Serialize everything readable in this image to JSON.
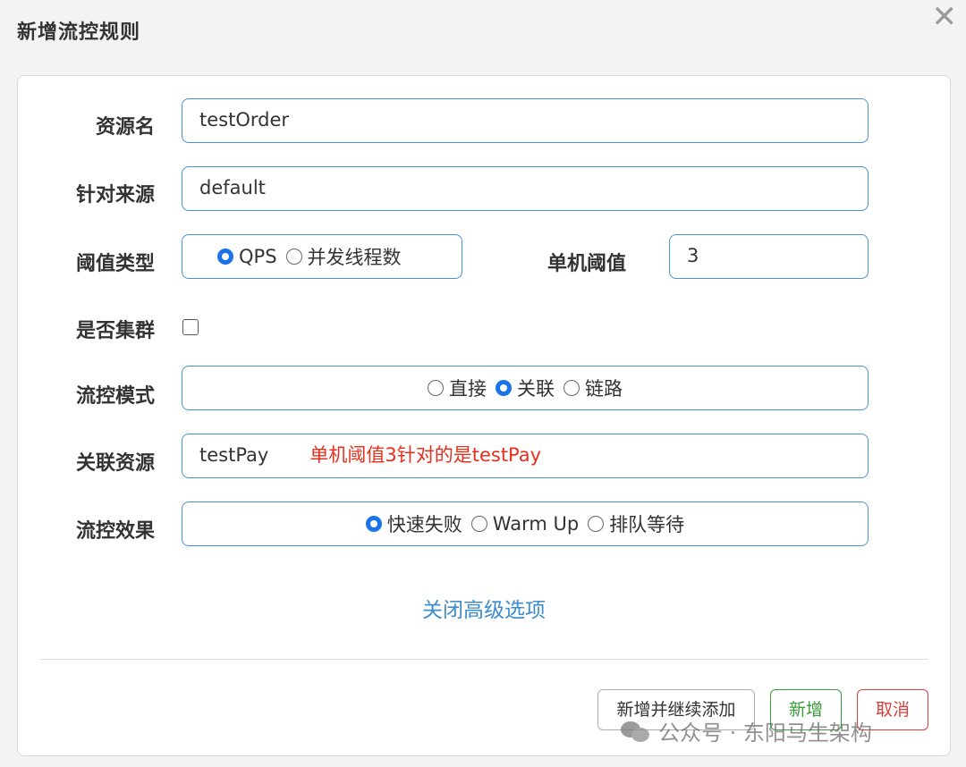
{
  "dialog": {
    "title": "新增流控规则",
    "close_symbol": "✕"
  },
  "form": {
    "resource_name": {
      "label": "资源名",
      "value": "testOrder"
    },
    "limit_app": {
      "label": "针对来源",
      "value": "default"
    },
    "threshold_type": {
      "label": "阈值类型",
      "options": [
        "QPS",
        "并发线程数"
      ],
      "selected": "QPS"
    },
    "threshold": {
      "label": "单机阈值",
      "value": "3"
    },
    "cluster": {
      "label": "是否集群",
      "checked": false
    },
    "strategy": {
      "label": "流控模式",
      "options": [
        "直接",
        "关联",
        "链路"
      ],
      "selected": "关联"
    },
    "ref_resource": {
      "label": "关联资源",
      "value": "testPay",
      "annotation": "单机阈值3针对的是testPay",
      "annotation_color": "#e6301c"
    },
    "control_behavior": {
      "label": "流控效果",
      "options": [
        "快速失败",
        "Warm Up",
        "排队等待"
      ],
      "selected": "快速失败"
    }
  },
  "advanced_link": "关闭高级选项",
  "buttons": {
    "add_continue": "新增并继续添加",
    "add": "新增",
    "cancel": "取消"
  },
  "watermark": "公众号 · 东阳马生架构",
  "colors": {
    "accent": "#4a90d9",
    "radio_on": "#1a73e8",
    "link": "#3d8dcc",
    "success": "#3a9b3a",
    "danger": "#d9403a"
  }
}
